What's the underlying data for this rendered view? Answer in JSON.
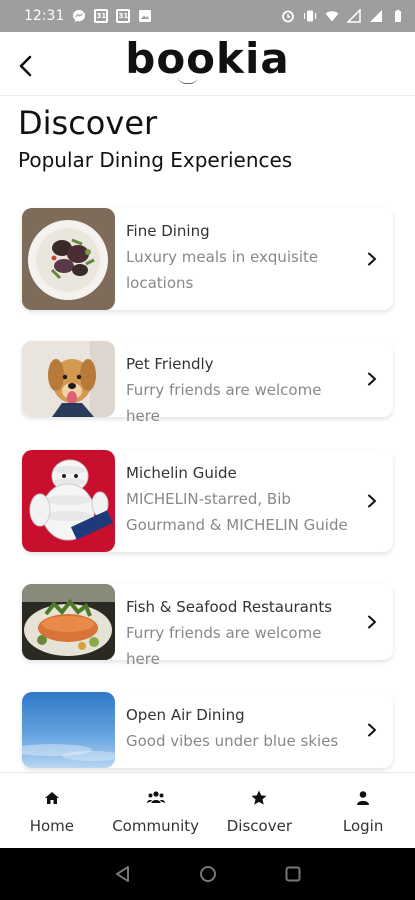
{
  "status_bar": {
    "time": "12:31",
    "cal1": "31",
    "cal2": "31"
  },
  "header": {
    "logo": "bookia"
  },
  "page": {
    "title": "Discover",
    "subtitle": "Popular Dining Experiences"
  },
  "cards": [
    {
      "title": "Fine Dining",
      "desc_line1": "Luxury meals in exquisite",
      "desc_line2": "locations",
      "image": "fine-dining-plate"
    },
    {
      "title": "Pet Friendly",
      "desc_line1": "Furry friends are welcome here",
      "desc_line2": "",
      "image": "golden-retriever"
    },
    {
      "title": "Michelin Guide",
      "desc_line1": "MICHELIN-starred, Bib",
      "desc_line2": "Gourmand & MICHELIN Guide",
      "image": "michelin-man"
    },
    {
      "title": "Fish & Seafood Restaurants",
      "desc_line1": "Furry friends are welcome here",
      "desc_line2": "",
      "image": "salmon-dish"
    },
    {
      "title": "Open Air Dining",
      "desc_line1": "Good vibes under blue skies",
      "desc_line2": "",
      "image": "blue-sky"
    }
  ],
  "bottom_nav": [
    {
      "label": "Home",
      "icon": "home-icon"
    },
    {
      "label": "Community",
      "icon": "users-icon"
    },
    {
      "label": "Discover",
      "icon": "star-icon"
    },
    {
      "label": "Login",
      "icon": "user-icon"
    }
  ],
  "colors": {
    "status_bar": "#9e9e9e",
    "card_title": "#333333",
    "card_desc": "#888888",
    "michelin_red": "#c8102e"
  }
}
